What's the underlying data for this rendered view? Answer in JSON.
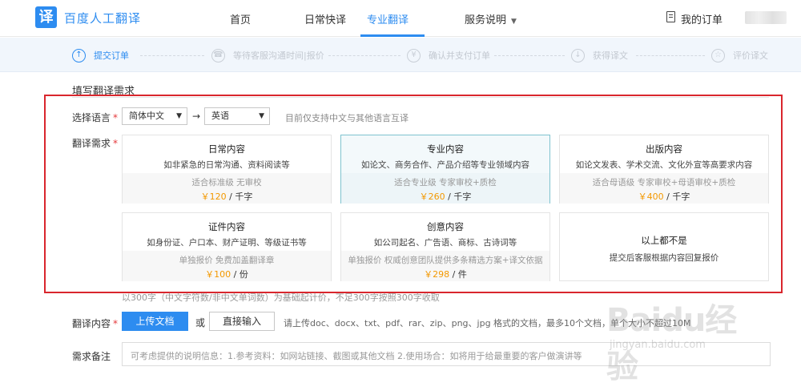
{
  "header": {
    "logo_mark": "译",
    "logo_text": "百度人工翻译",
    "nav": [
      {
        "label": "首页"
      },
      {
        "label": "日常快译"
      },
      {
        "label": "专业翻译"
      },
      {
        "label": "服务说明"
      }
    ],
    "orders": "我的订单",
    "brand_color": "#2d8cf0"
  },
  "steps": [
    {
      "label": "提交订单",
      "icon": "upload-icon",
      "glyph": "↑"
    },
    {
      "label": "等待客服沟通时间|报价",
      "icon": "headset-icon",
      "glyph": "☎"
    },
    {
      "label": "确认并支付订单",
      "icon": "yen-icon",
      "glyph": "¥"
    },
    {
      "label": "获得译文",
      "icon": "download-icon",
      "glyph": "↓"
    },
    {
      "label": "评价译文",
      "icon": "star-icon",
      "glyph": "☆"
    }
  ],
  "section_title": "填写翻译需求",
  "form": {
    "language_label": "选择语言",
    "source_language": "简体中文",
    "target_language": "英语",
    "arrow": "→",
    "language_hint": "目前仅支持中文与其他语言互译",
    "need_label": "翻译需求",
    "required_mark": "*"
  },
  "cards": [
    {
      "title": "日常内容",
      "desc": "如非紧急的日常沟通、资料阅读等",
      "sub": "适合标准级 无审校",
      "price": "￥120",
      "unit": " / 千字"
    },
    {
      "title": "专业内容",
      "desc": "如论文、商务合作、产品介绍等专业领域内容",
      "sub": "适合专业级 专家审校+质检",
      "price": "￥260",
      "unit": " / 千字"
    },
    {
      "title": "出版内容",
      "desc": "如论文发表、学术交流、文化外宣等高要求内容",
      "sub": "适合母语级 专家审校+母语审校+质检",
      "price": "￥400",
      "unit": " / 千字"
    },
    {
      "title": "证件内容",
      "desc": "如身份证、户口本、财产证明、等级证书等",
      "sub": "单独报价 免费加盖翻译章",
      "price": "￥100",
      "unit": " / 份"
    },
    {
      "title": "创意内容",
      "desc": "如公司起名、广告语、商标、古诗词等",
      "sub": "单独报价 权威创意团队提供多条精选方案+译文依据",
      "price": "￥298",
      "unit": " / 件"
    },
    {
      "title": "以上都不是",
      "desc": "提交后客服根据内容回复报价"
    }
  ],
  "note": "以300字（中文字符数/非中文单词数）为基础起计价，不足300字按照300字收取",
  "upload": {
    "label": "翻译内容",
    "upload_button": "上传文档",
    "or": "或",
    "input_button": "直接输入",
    "hint": "请上传doc、docx、txt、pdf、rar、zip、png、jpg 格式的文档，最多10个文档，单个大小不超过10M"
  },
  "remarks": {
    "label": "需求备注",
    "placeholder": "可考虑提供的说明信息：1.参考资料：如网站链接、截图或其他文档  2.使用场合：如将用于给最重要的客户做演讲等"
  },
  "watermark": {
    "main": "Baidu经验",
    "url": "jingyan.baidu.com"
  }
}
